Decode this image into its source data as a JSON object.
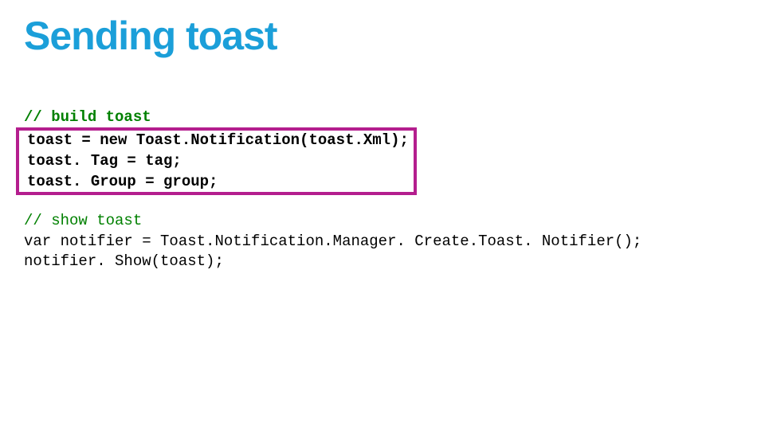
{
  "slide": {
    "title": "Sending toast",
    "code": {
      "comment1": "// build toast",
      "box_line1": "toast = new Toast.Notification(toast.Xml);",
      "box_line2": "toast. Tag = tag;",
      "box_line3": "toast. Group = group;",
      "comment2": "// show toast",
      "line_notifier": "var notifier = Toast.Notification.Manager. Create.Toast. Notifier();",
      "line_show": "notifier. Show(toast);"
    }
  }
}
